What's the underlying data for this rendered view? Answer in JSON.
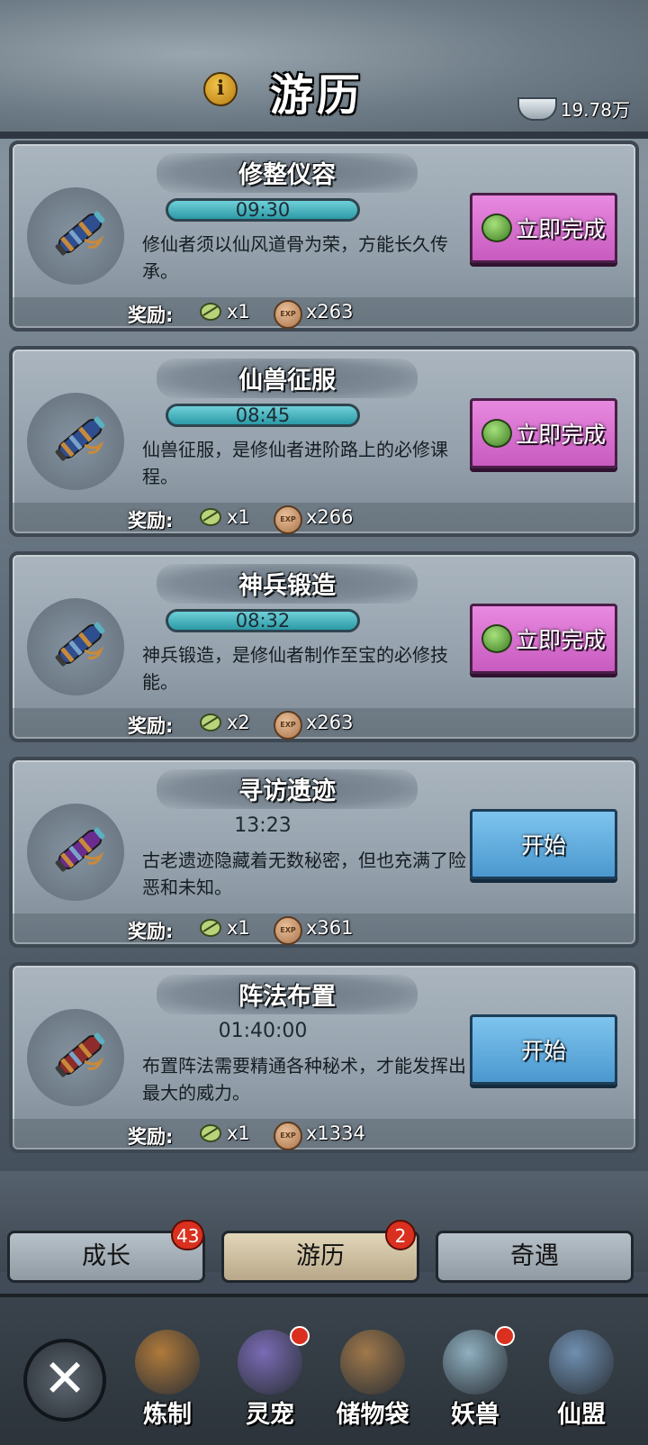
{
  "header": {
    "title": "游历",
    "currency_value": "19.78万"
  },
  "tasks": [
    {
      "title": "修整仪容",
      "timer": "09:30",
      "timer_style": "bar",
      "desc": "修仙者须以仙风道骨为荣，方能长久传承。",
      "action": "立即完成",
      "action_type": "complete",
      "reward_label": "奖励:",
      "reward_item_count": "x1",
      "reward_item_icon": "map-scroll-icon",
      "exp_count": "x263",
      "scroll_color": "#2f4e8f"
    },
    {
      "title": "仙兽征服",
      "timer": "08:45",
      "timer_style": "bar",
      "desc": "仙兽征服，是修仙者进阶路上的必修课程。",
      "action": "立即完成",
      "action_type": "complete",
      "reward_label": "奖励:",
      "reward_item_count": "x1",
      "reward_item_icon": "leaf-icon",
      "exp_count": "x266",
      "scroll_color": "#2f4e8f"
    },
    {
      "title": "神兵锻造",
      "timer": "08:32",
      "timer_style": "bar",
      "desc": "神兵锻造，是修仙者制作至宝的必修技能。",
      "action": "立即完成",
      "action_type": "complete",
      "reward_label": "奖励:",
      "reward_item_count": "x2",
      "reward_item_icon": "paper-scroll-icon",
      "exp_count": "x263",
      "scroll_color": "#2f4e8f"
    },
    {
      "title": "寻访遗迹",
      "timer": "13:23",
      "timer_style": "plain",
      "desc": "古老遗迹隐藏着无数秘密，但也充满了险恶和未知。",
      "action": "开始",
      "action_type": "start",
      "reward_label": "奖励:",
      "reward_item_count": "x1",
      "reward_item_icon": "herb-icon",
      "exp_count": "x361",
      "scroll_color": "#6a2c8e"
    },
    {
      "title": "阵法布置",
      "timer": "01:40:00",
      "timer_style": "plain",
      "desc": "布置阵法需要精通各种秘术，才能发挥出最大的威力。",
      "action": "开始",
      "action_type": "start",
      "reward_label": "奖励:",
      "reward_item_count": "x1",
      "reward_item_icon": "talisman-coin-icon",
      "exp_count": "x1334",
      "scroll_color": "#8e2c2c"
    }
  ],
  "tabs": [
    {
      "label": "成长",
      "badge": "43"
    },
    {
      "label": "游历",
      "badge": "2"
    },
    {
      "label": "奇遇",
      "badge": ""
    }
  ],
  "nav": [
    {
      "label": "炼制",
      "icon": "furnace-icon",
      "dot": false
    },
    {
      "label": "灵宠",
      "icon": "spirit-pet-icon",
      "dot": true
    },
    {
      "label": "储物袋",
      "icon": "storage-bag-icon",
      "dot": false
    },
    {
      "label": "妖兽",
      "icon": "demon-beast-icon",
      "dot": true
    },
    {
      "label": "仙盟",
      "icon": "pavilion-icon",
      "dot": false
    }
  ],
  "exp_icon_text": "EXP",
  "colors": {
    "complete_button": "#d870cf",
    "start_button": "#5fa9dc",
    "timer_bar": "#3fb0bb",
    "badge": "#d9301f"
  }
}
